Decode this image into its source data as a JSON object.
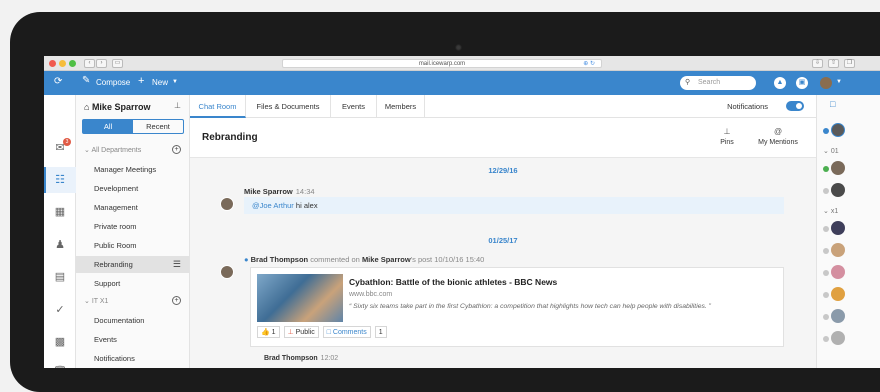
{
  "browser": {
    "url": "mail.icewarp.com",
    "url_action": "⊕ ↻"
  },
  "toolbar": {
    "compose_label": "Compose",
    "new_label": "New",
    "search_placeholder": "Search"
  },
  "rail": {
    "mail_badge": "3"
  },
  "panel": {
    "owner": "Mike Sparrow",
    "filter_all": "All",
    "filter_recent": "Recent",
    "groups": [
      {
        "label": "All Departments",
        "items": [
          "Manager Meetings",
          "Development",
          "Management",
          "Private room",
          "Public Room",
          "Rebranding",
          "Support"
        ]
      },
      {
        "label": "IT X1",
        "items": [
          "Documentation",
          "Events",
          "Notifications"
        ]
      }
    ]
  },
  "tabs": [
    "Chat Room",
    "Files & Documents",
    "Events",
    "Members"
  ],
  "notifications_label": "Notifications",
  "room": {
    "title": "Rebranding",
    "pins_label": "Pins",
    "mentions_label": "My Mentions"
  },
  "feed": {
    "date1": "12/29/16",
    "msg1_sender": "Mike Sparrow",
    "msg1_time": "14:34",
    "msg1_mention": "@Joe Arthur",
    "msg1_text": "hi alex",
    "date2": "01/25/17",
    "post_author": "Brad Thompson",
    "post_mid": "commented on",
    "post_owner": "Mike Sparrow",
    "post_suffix": "'s post",
    "post_time": "10/10/16 15:40",
    "card_title": "Cybathlon: Battle of the bionic athletes - BBC News",
    "card_url": "www.bbc.com",
    "card_desc": "“ Sixty six teams take part in the first Cybathlon: a competition that highlights how tech can help people with disabilities. ”",
    "like_count": "1",
    "public_label": "Public",
    "comments_label": "Comments",
    "comments_count": "1",
    "next_sender": "Brad Thompson",
    "next_time": "12:02"
  },
  "right_rail": {
    "group1": "01",
    "group2": "x1"
  }
}
